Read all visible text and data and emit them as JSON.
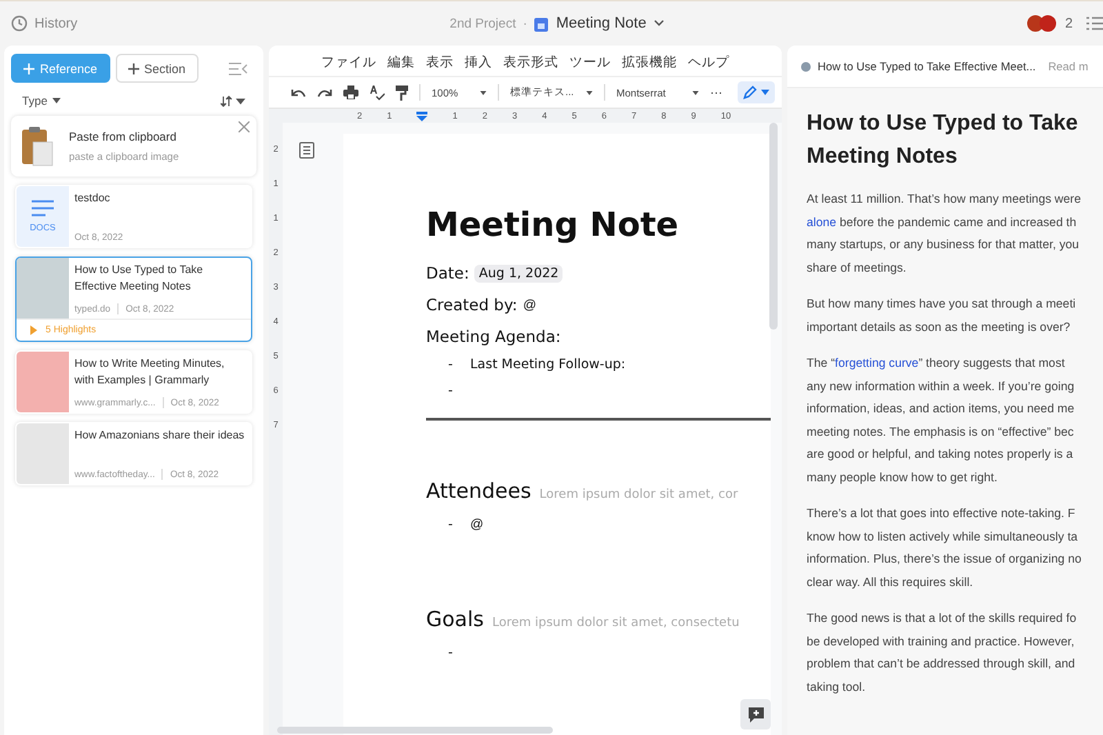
{
  "topbar": {
    "history": "History",
    "project": "2nd Project",
    "separator": "·",
    "doc_title": "Meeting Note",
    "collaborator_count": "2"
  },
  "sidebar": {
    "buttons": [
      {
        "label": "Reference",
        "kind": "primary"
      },
      {
        "label": "Section",
        "kind": "secondary"
      }
    ],
    "filter": "Type",
    "clipboard": {
      "title": "Paste from clipboard",
      "hint": "paste a clipboard image"
    },
    "items": [
      {
        "kind": "doc",
        "badge": "DOCS",
        "title": "testdoc",
        "date": "Oct 8, 2022",
        "selected": false
      },
      {
        "kind": "web",
        "title": "How to Use Typed to Take Effective Meeting Notes",
        "source": "typed.do",
        "date": "Oct 8, 2022",
        "highlights": "5 Highlights",
        "selected": true
      },
      {
        "kind": "web",
        "title": "How to Write Meeting Minutes, with Examples | Grammarly",
        "source": "www.grammarly.c...",
        "date": "Oct 8, 2022",
        "selected": false
      },
      {
        "kind": "web",
        "title": "How Amazonians share their ideas",
        "source": "www.factoftheday...",
        "date": "Oct 8, 2022",
        "selected": false
      }
    ]
  },
  "editor": {
    "menu": [
      "ファイル",
      "編集",
      "表示",
      "挿入",
      "表示形式",
      "ツール",
      "拡張機能",
      "ヘルプ"
    ],
    "zoom": "100%",
    "style": "標準テキス...",
    "font": "Montserrat",
    "more": "⋯",
    "ruler": [
      "2",
      "1",
      "1",
      "2",
      "3",
      "4",
      "5",
      "6",
      "7",
      "8",
      "9",
      "10"
    ],
    "vruler": [
      "2",
      "1",
      "1",
      "2",
      "3",
      "4",
      "5",
      "6",
      "7"
    ],
    "title": "Meeting Note",
    "date_label": "Date:",
    "date_value": "Aug 1, 2022",
    "created_label": "Created by:",
    "created_value": "@",
    "agenda_label": "Meeting Agenda:",
    "agenda_items": [
      {
        "kind": "text",
        "text": "Last Meeting Follow-up:"
      },
      {
        "kind": "blank"
      }
    ],
    "sections": [
      {
        "heading": "Attendees",
        "hint": "Lorem ipsum dolor sit amet, cor",
        "items": [
          {
            "kind": "text",
            "text": "@"
          }
        ]
      },
      {
        "heading": "Goals",
        "hint": "Lorem ipsum dolor sit amet, consectetu",
        "items": [
          {
            "kind": "blank"
          }
        ]
      }
    ],
    "bullet": "-"
  },
  "reader": {
    "tab_title": "How to Use Typed to Take Effective Meet...",
    "tab_action": "Read m",
    "title": "How to Use Typed to Take Meeting Notes",
    "paragraphs": [
      [
        [
          {
            "text": "At least 11 million. That’s how many meetings were",
            "link": false
          }
        ],
        [
          {
            "text": "alone",
            "link": true
          },
          {
            "text": " before the pandemic came and increased th",
            "link": false
          }
        ],
        [
          {
            "text": "many startups, or any business for that matter, you",
            "link": false
          }
        ],
        [
          {
            "text": "share of meetings.",
            "link": false
          }
        ]
      ],
      [
        [
          {
            "text": "But how many times have you sat through a meeti",
            "link": false
          }
        ],
        [
          {
            "text": "important details as soon as the meeting is over?",
            "link": false
          }
        ]
      ],
      [
        [
          {
            "text": "The “",
            "link": false
          },
          {
            "text": "forgetting curve",
            "link": true
          },
          {
            "text": "” theory suggests that most",
            "link": false
          }
        ],
        [
          {
            "text": "any new information within a week. If you’re going",
            "link": false
          }
        ],
        [
          {
            "text": "information, ideas, and action items, you need me",
            "link": false
          }
        ],
        [
          {
            "text": "meeting notes. The emphasis is on “effective” bec",
            "link": false
          }
        ],
        [
          {
            "text": "are good or helpful, and taking notes properly is a",
            "link": false
          }
        ],
        [
          {
            "text": "many people know how to get right.",
            "link": false
          }
        ]
      ],
      [
        [
          {
            "text": "There’s a lot that goes into effective note-taking. F",
            "link": false
          }
        ],
        [
          {
            "text": "know how to listen actively while simultaneously ta",
            "link": false
          }
        ],
        [
          {
            "text": "information. Plus, there’s the issue of organizing no",
            "link": false
          }
        ],
        [
          {
            "text": "clear way. All this requires skill.",
            "link": false
          }
        ]
      ],
      [
        [
          {
            "text": "The good news is that a lot of the skills required fo",
            "link": false
          }
        ],
        [
          {
            "text": "be developed with training and practice. However,",
            "link": false
          }
        ],
        [
          {
            "text": "problem that can’t be addressed through skill, and",
            "link": false
          }
        ],
        [
          {
            "text": "taking tool.",
            "link": false
          }
        ]
      ]
    ]
  }
}
